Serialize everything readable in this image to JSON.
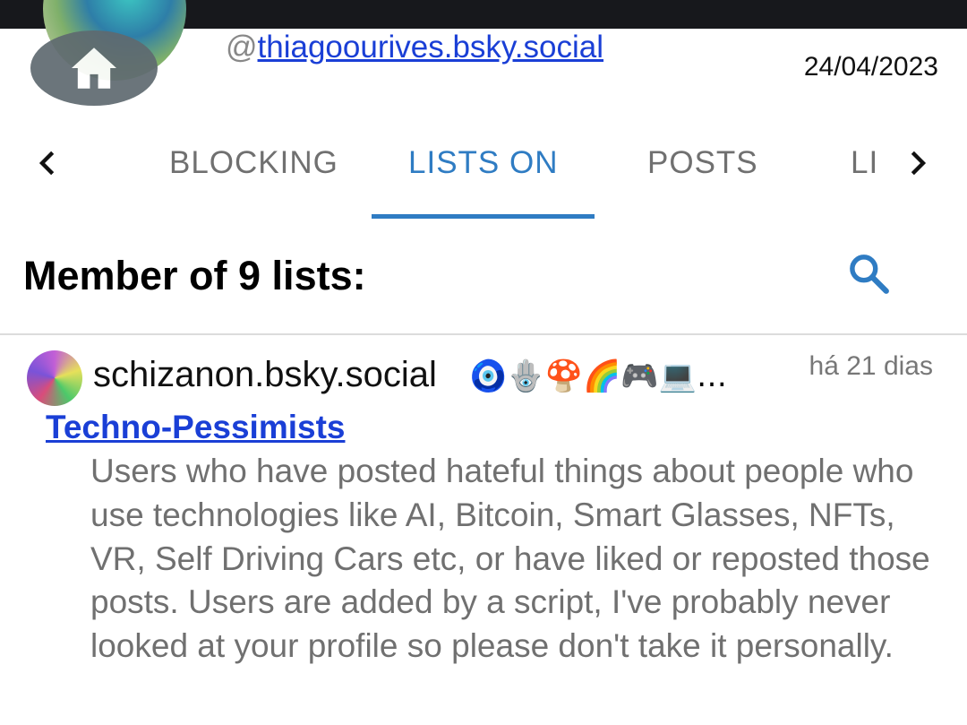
{
  "header": {
    "handle_prefix": "@",
    "handle": "thiagoourives.bsky.social",
    "date": "24/04/2023",
    "home_icon": "home-icon"
  },
  "tabs": {
    "items": [
      {
        "label": "BLOCKING",
        "active": false
      },
      {
        "label": "LISTS ON",
        "active": true
      },
      {
        "label": "POSTS",
        "active": false
      },
      {
        "label": "LIKES",
        "active": false
      }
    ],
    "prev_icon": "chevron-left-icon",
    "next_icon": "chevron-right-icon",
    "active_color": "#2f7cc3"
  },
  "section": {
    "title": "Member of 9 lists:",
    "search_icon": "search-icon"
  },
  "list": {
    "owner": "schizanon.bsky.social",
    "owner_emoji": "🧿🪬🍄🌈🎮💻…",
    "time_ago": "há 21 dias",
    "title": "Techno-Pessimists",
    "description": "Users who have posted hateful things about people who use technologies like AI, Bitcoin, Smart Glasses, NFTs, VR, Self Driving Cars etc, or have liked or reposted those posts. Users are added by a script, I've probably never looked at your profile so please don't take it personally.",
    "link_color": "#1a3fd6"
  }
}
